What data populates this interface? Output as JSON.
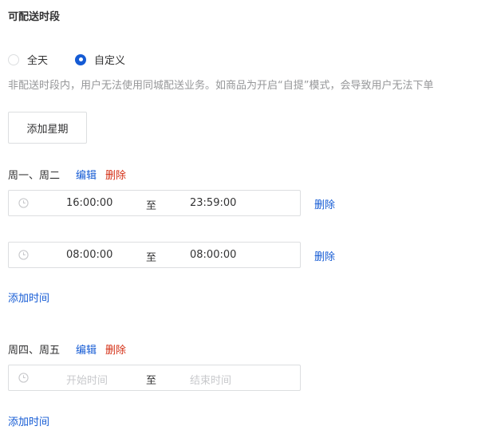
{
  "section": {
    "title": "可配送时段"
  },
  "radios": [
    {
      "label": "全天",
      "checked": false
    },
    {
      "label": "自定义",
      "checked": true
    }
  ],
  "description": "非配送时段内，用户无法使用同城配送业务。如商品为开启“自提”模式，会导致用户无法下单",
  "add_week_button": "添加星期",
  "groups": [
    {
      "title": "周一、周二",
      "edit": "编辑",
      "delete": "删除",
      "ranges": [
        {
          "start": "16:00:00",
          "sep": "至",
          "end": "23:59:00",
          "delete": "删除"
        },
        {
          "start": "08:00:00",
          "sep": "至",
          "end": "08:00:00",
          "delete": "删除"
        }
      ],
      "add_time": "添加时间"
    },
    {
      "title": "周四、周五",
      "edit": "编辑",
      "delete": "删除",
      "ranges": [
        {
          "start_placeholder": "开始时间",
          "sep": "至",
          "end_placeholder": "结束时间"
        }
      ],
      "add_time": "添加时间"
    }
  ],
  "icons": {
    "clock": "clock-icon"
  },
  "colors": {
    "accent": "#155bd4",
    "danger": "#d42f15",
    "muted": "#969799",
    "placeholder": "#c8c9cc",
    "border": "#dcdee0"
  }
}
